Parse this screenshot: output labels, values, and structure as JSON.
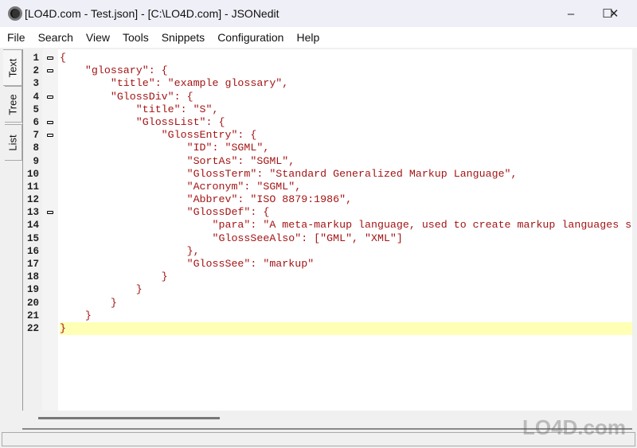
{
  "window": {
    "title": "[LO4D.com - Test.json] - [C:\\LO4D.com] - JSONedit",
    "minimize": "–",
    "maximize": "☐",
    "close": "✕"
  },
  "menu": [
    "File",
    "Search",
    "View",
    "Tools",
    "Snippets",
    "Configuration",
    "Help"
  ],
  "tabs": [
    "Text",
    "Tree",
    "List"
  ],
  "colors": {
    "string": "#a31515",
    "current_line": "#ffffb5"
  },
  "code_lines": [
    {
      "n": "1",
      "fold": true,
      "t": "{"
    },
    {
      "n": "2",
      "fold": true,
      "t": "    \"glossary\": {"
    },
    {
      "n": "3",
      "fold": false,
      "t": "        \"title\": \"example glossary\","
    },
    {
      "n": "4",
      "fold": true,
      "t": "        \"GlossDiv\": {"
    },
    {
      "n": "5",
      "fold": false,
      "t": "            \"title\": \"S\","
    },
    {
      "n": "6",
      "fold": true,
      "t": "            \"GlossList\": {"
    },
    {
      "n": "7",
      "fold": true,
      "t": "                \"GlossEntry\": {"
    },
    {
      "n": "8",
      "fold": false,
      "t": "                    \"ID\": \"SGML\","
    },
    {
      "n": "9",
      "fold": false,
      "t": "                    \"SortAs\": \"SGML\","
    },
    {
      "n": "10",
      "fold": false,
      "t": "                    \"GlossTerm\": \"Standard Generalized Markup Language\","
    },
    {
      "n": "11",
      "fold": false,
      "t": "                    \"Acronym\": \"SGML\","
    },
    {
      "n": "12",
      "fold": false,
      "t": "                    \"Abbrev\": \"ISO 8879:1986\","
    },
    {
      "n": "13",
      "fold": true,
      "t": "                    \"GlossDef\": {"
    },
    {
      "n": "14",
      "fold": false,
      "t": "                        \"para\": \"A meta-markup language, used to create markup languages s"
    },
    {
      "n": "15",
      "fold": false,
      "t": "                        \"GlossSeeAlso\": [\"GML\", \"XML\"]"
    },
    {
      "n": "16",
      "fold": false,
      "t": "                    },"
    },
    {
      "n": "17",
      "fold": false,
      "t": "                    \"GlossSee\": \"markup\""
    },
    {
      "n": "18",
      "fold": false,
      "t": "                }"
    },
    {
      "n": "19",
      "fold": false,
      "t": "            }"
    },
    {
      "n": "20",
      "fold": false,
      "t": "        }"
    },
    {
      "n": "21",
      "fold": false,
      "t": "    }"
    },
    {
      "n": "22",
      "fold": false,
      "t": "}"
    }
  ],
  "watermark": "LO4D.com"
}
